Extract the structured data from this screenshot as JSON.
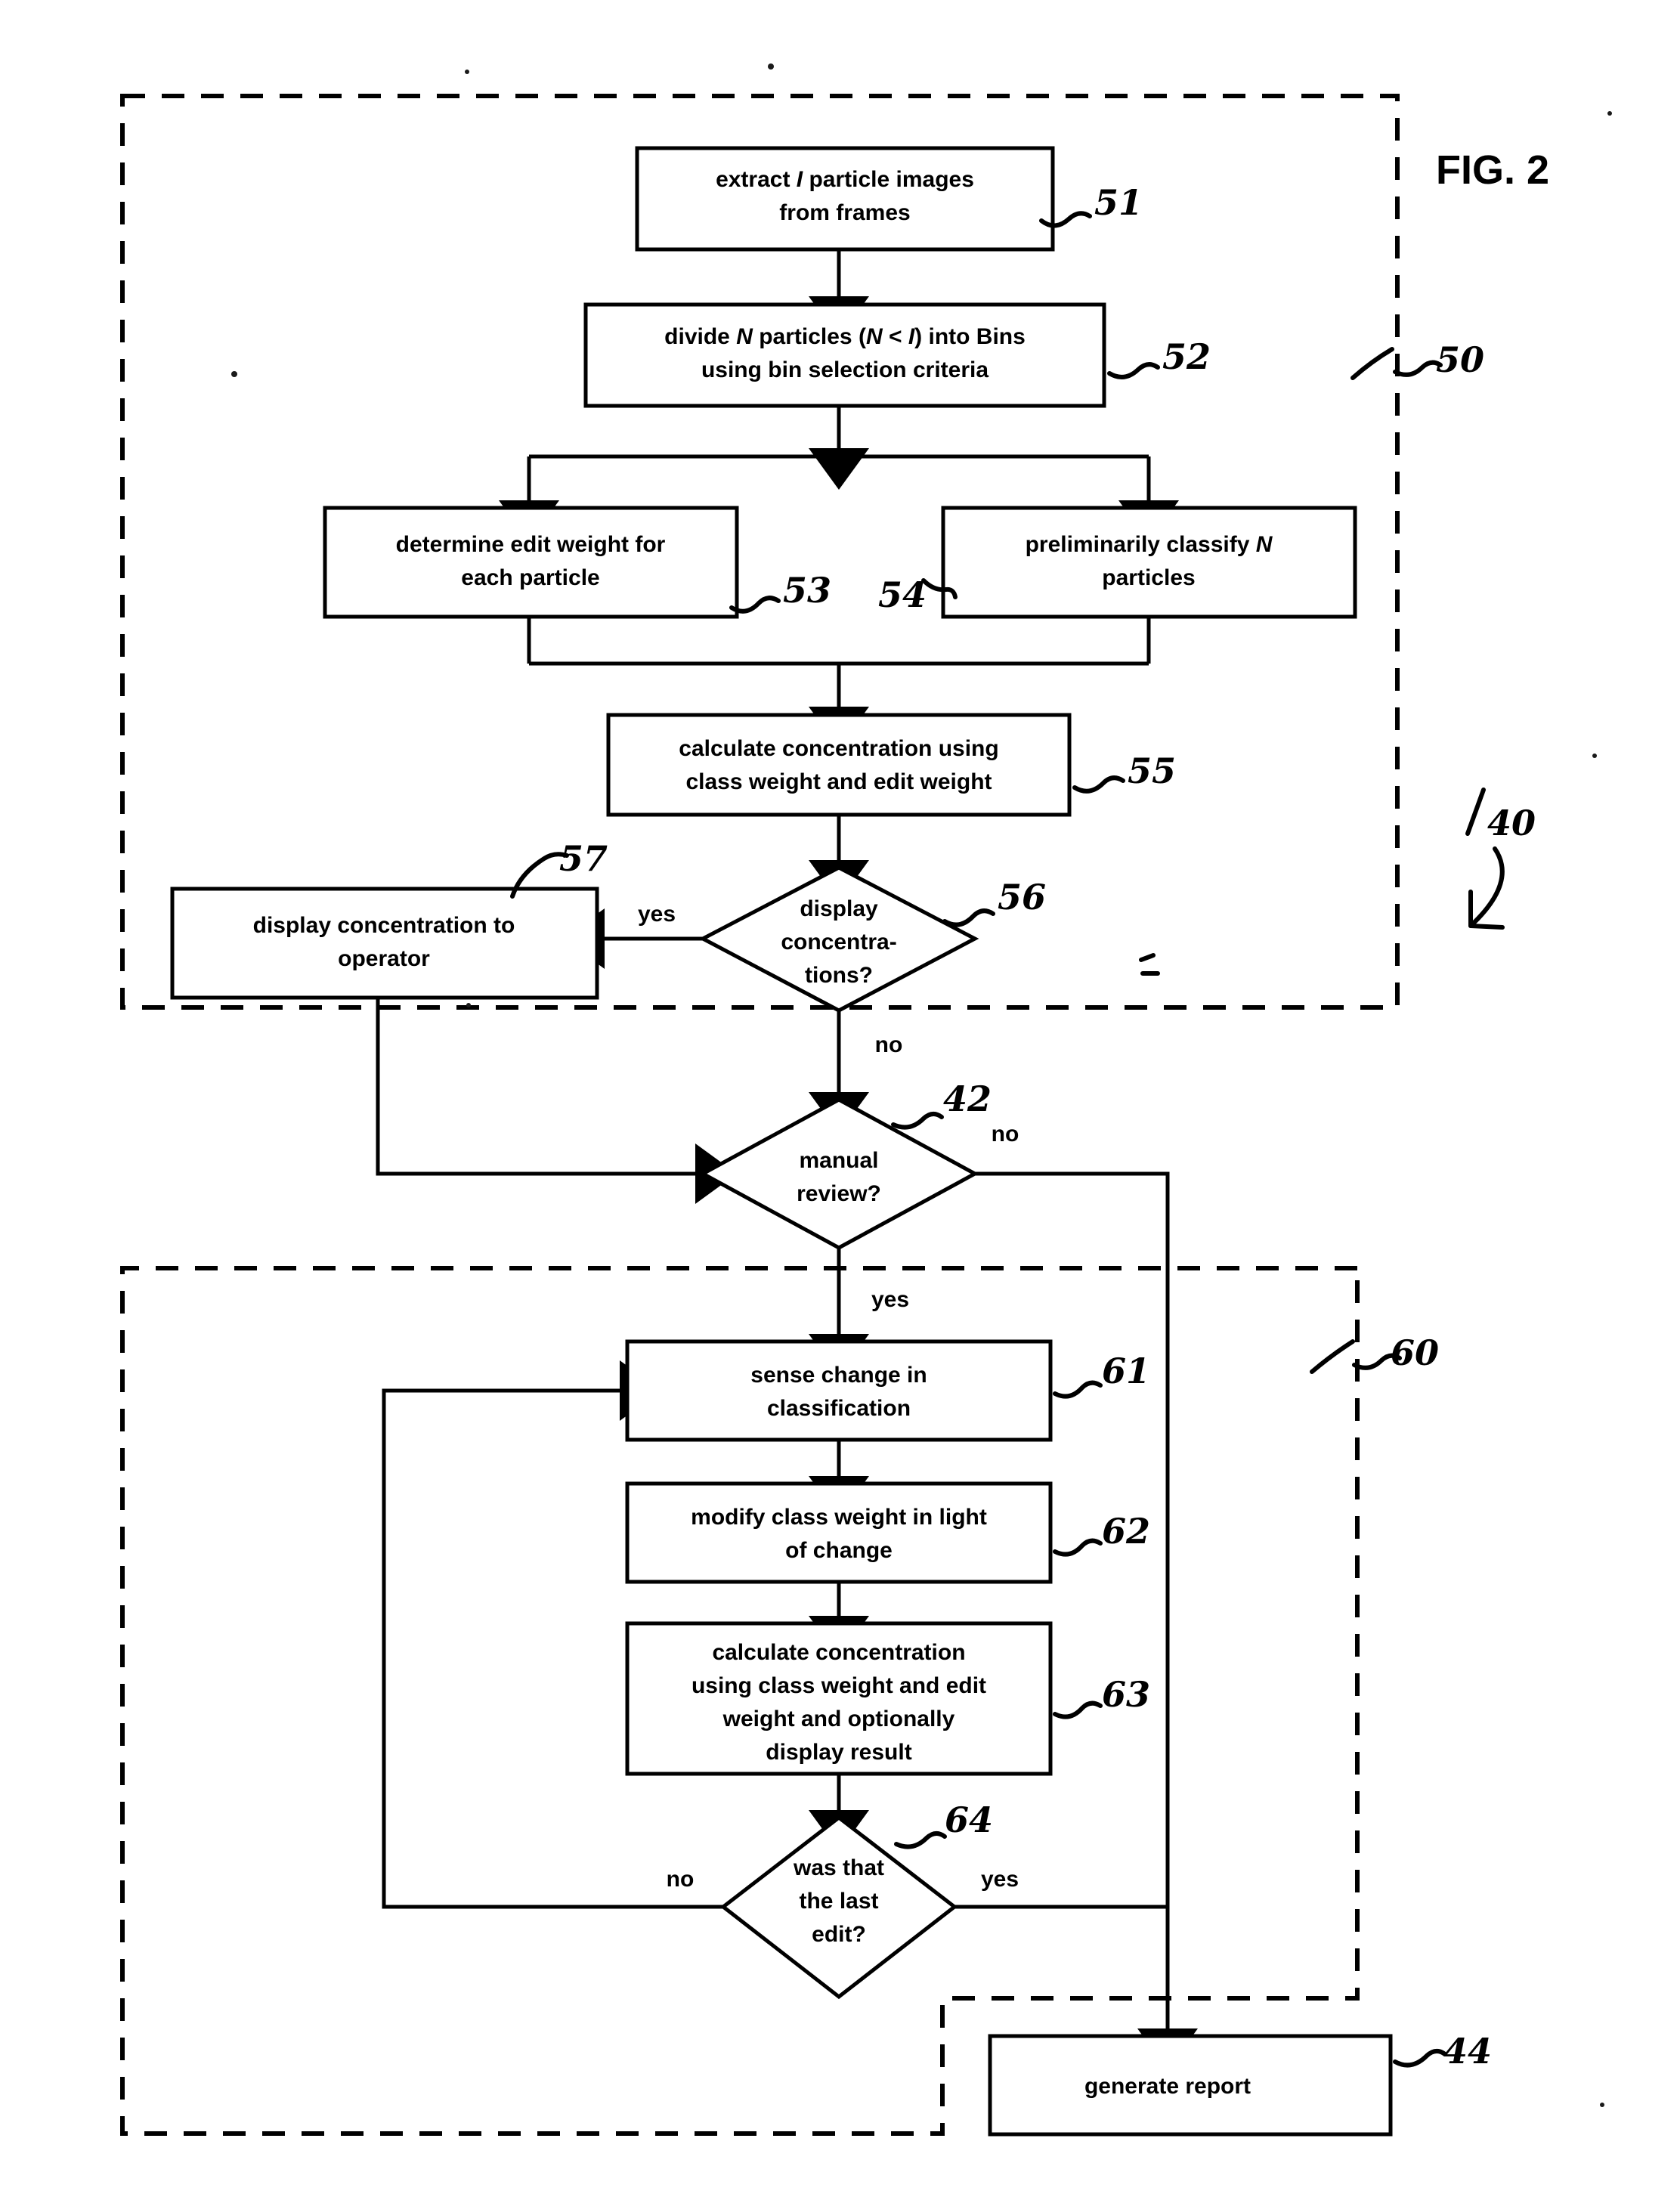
{
  "figure": {
    "label": "FIG. 2",
    "title": "FIG. 2"
  },
  "reference_numerals": {
    "group_upper": "50",
    "group_overall": "40",
    "group_lower": "60",
    "n51": "51",
    "n52": "52",
    "n53": "53",
    "n54": "54",
    "n55": "55",
    "n56": "56",
    "n57": "57",
    "n42": "42",
    "n61": "61",
    "n62": "62",
    "n63": "63",
    "n64": "64",
    "n44": "44"
  },
  "nodes": {
    "n51": {
      "id": "51",
      "shape": "process",
      "lines": [
        "extract I particle images",
        "from frames"
      ],
      "line1_pre": "extract ",
      "line1_ital": "I",
      "line1_post": " particle images",
      "line2": "from frames"
    },
    "n52": {
      "id": "52",
      "shape": "process",
      "lines": [
        "divide N particles (N < I) into  Bins",
        "using bin selection criteria"
      ],
      "line1_a": "divide ",
      "line1_i1": "N",
      "line1_b": " particles (",
      "line1_i2": "N",
      "line1_c": " < ",
      "line1_i3": "I",
      "line1_d": ") into  Bins",
      "line2": "using bin selection criteria"
    },
    "n53": {
      "id": "53",
      "shape": "process",
      "lines": [
        "determine  edit weight  for",
        "each particle"
      ],
      "line1": "determine  edit weight  for",
      "line2": "each particle"
    },
    "n54": {
      "id": "54",
      "shape": "process",
      "lines": [
        "preliminarily classify N",
        "particles"
      ],
      "line1_a": "preliminarily classify ",
      "line1_i": "N",
      "line2": "particles"
    },
    "n55": {
      "id": "55",
      "shape": "process",
      "lines": [
        "calculate concentration using",
        "class weight and edit weight"
      ],
      "line1": "calculate concentration using",
      "line2": "class weight and edit weight"
    },
    "n56": {
      "id": "56",
      "shape": "decision",
      "lines": [
        "display",
        "concentra-",
        "tions?"
      ],
      "line1": "display",
      "line2": "concentra-",
      "line3": "tions?"
    },
    "n57": {
      "id": "57",
      "shape": "process",
      "lines": [
        "display concentration to",
        "operator"
      ],
      "line1": "display concentration to",
      "line2": "operator"
    },
    "n42": {
      "id": "42",
      "shape": "decision",
      "lines": [
        "manual",
        "review?"
      ],
      "line1": "manual",
      "line2": "review?"
    },
    "n61": {
      "id": "61",
      "shape": "process",
      "lines": [
        "sense change in",
        "classification"
      ],
      "line1": "sense change in",
      "line2": "classification"
    },
    "n62": {
      "id": "62",
      "shape": "process",
      "lines": [
        "modify class weight in light",
        "of change"
      ],
      "line1": "modify class weight in light",
      "line2": "of change"
    },
    "n63": {
      "id": "63",
      "shape": "process",
      "lines": [
        "calculate concentration",
        "using class weight and edit",
        "weight and optionally",
        "display result"
      ],
      "line1": "calculate concentration",
      "line2": "using class weight and edit",
      "line3": "weight and optionally",
      "line4": "display result"
    },
    "n64": {
      "id": "64",
      "shape": "decision",
      "lines": [
        "was that",
        "the last",
        "edit?"
      ],
      "line1": "was that",
      "line2": "the last",
      "line3": "edit?"
    },
    "n44": {
      "id": "44",
      "shape": "process",
      "lines": [
        "generate report"
      ],
      "line1": "generate report"
    }
  },
  "edge_labels": {
    "e56_yes": "yes",
    "e56_no": "no",
    "e42_no": "no",
    "e42_yes": "yes",
    "e64_no": "no",
    "e64_yes": "yes"
  },
  "colors": {
    "ink": "#000000",
    "paper": "#ffffff"
  }
}
